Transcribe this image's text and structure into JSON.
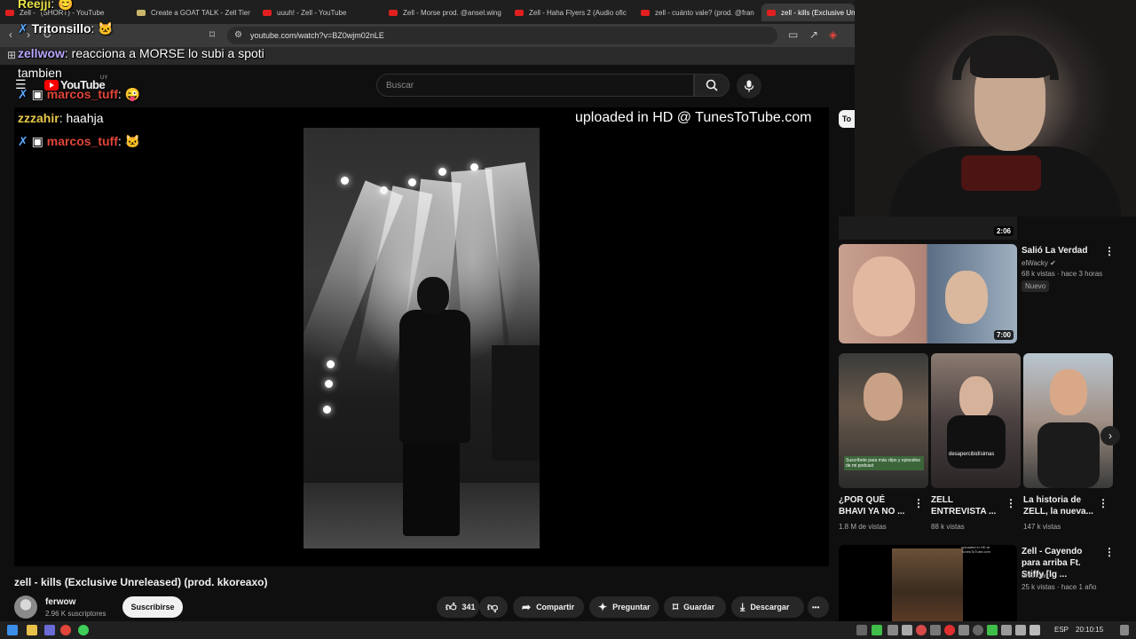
{
  "browser": {
    "tabs": [
      {
        "label": "Zell - ",
        "label2": "(SHORT) - YouTube",
        "type": "yt"
      },
      {
        "label": "Create a GOAT TALK - Zell Tier",
        "type": "doc"
      },
      {
        "label": "uuuh! - Zell - YouTube",
        "type": "yt"
      },
      {
        "label": "Zell - Morse prod. @ansel.wing",
        "type": "yt"
      },
      {
        "label": "Zell - Haha Flyers 2 (Audio ofic",
        "type": "yt"
      },
      {
        "label": "zell - cuánto vale? (prod. @fran",
        "type": "yt"
      },
      {
        "label": "zell - kills (Exclusive Unr",
        "type": "yt",
        "active": true
      }
    ],
    "url": "youtube.com/watch?v=BZ0wjm02nLE"
  },
  "youtube": {
    "logo_text": "YouTube",
    "logo_region": "UY",
    "search_placeholder": "Buscar"
  },
  "player": {
    "watermark": "uploaded in HD @ TunesToTube.com"
  },
  "chat": [
    {
      "user": "Reejji",
      "text": ":",
      "emote": "😊",
      "user_color": "#e8e24a"
    },
    {
      "user": "Tritonsillo",
      "text": ":",
      "emote": "🐱",
      "user_color": "#ffffff"
    },
    {
      "user": "zellwow",
      "text": ": reacciona a MORSE lo subi a spoti",
      "user_color": "#b9a5ff"
    },
    {
      "user": "",
      "text": "tambien",
      "user_color": "#ffffff"
    },
    {
      "user": "marcos_tuff",
      "text": ":",
      "emote": "😜",
      "user_color": "#e0453a"
    },
    {
      "user": "zzzahir",
      "text": ": haahja",
      "user_color": "#e8c84a"
    },
    {
      "user": "marcos_tuff",
      "text": ":",
      "emote": "🐱",
      "user_color": "#e0453a"
    }
  ],
  "video": {
    "title": "zell - kills (Exclusive Unreleased) (prod. kkoreaxo)",
    "channel": "ferwow",
    "subscribers": "2.96 K suscriptores",
    "subscribe_label": "Suscribirse",
    "likes": "341",
    "share_label": "Compartir",
    "ask_label": "Preguntar",
    "save_label": "Guardar",
    "download_label": "Descargar",
    "more_label": "•••"
  },
  "sidebar": {
    "chip": "To",
    "short_duration": "2:06",
    "item1": {
      "title": "Salió La Verdad",
      "channel": "elWacky",
      "meta": "68 k vistas · hace 3 horas",
      "badge": "Nuevo",
      "duration": "7:00"
    },
    "shorts": [
      {
        "title": "¿POR QUÉ BHAVI YA NO ...",
        "meta": "1.8 M de vistas",
        "caption": "Suscríbete para más clips y episodios de mi podcast"
      },
      {
        "title": "ZELL ENTREVISTA ...",
        "meta": "88 k vistas",
        "caption": "desapercibidísimas"
      },
      {
        "title": "La historia de ZELL, la nueva...",
        "meta": "147 k vistas",
        "caption": ""
      }
    ],
    "item2": {
      "title": "Zell - Cayendo para arriba Ft. Stiffy [lg ...",
      "channel": "unknow",
      "meta": "25 k vistas · hace 1 año",
      "thumb_label": "uploaded in HD at TunesToTube.com"
    }
  },
  "taskbar": {
    "lang": "ESP",
    "time": "20:10:15"
  }
}
